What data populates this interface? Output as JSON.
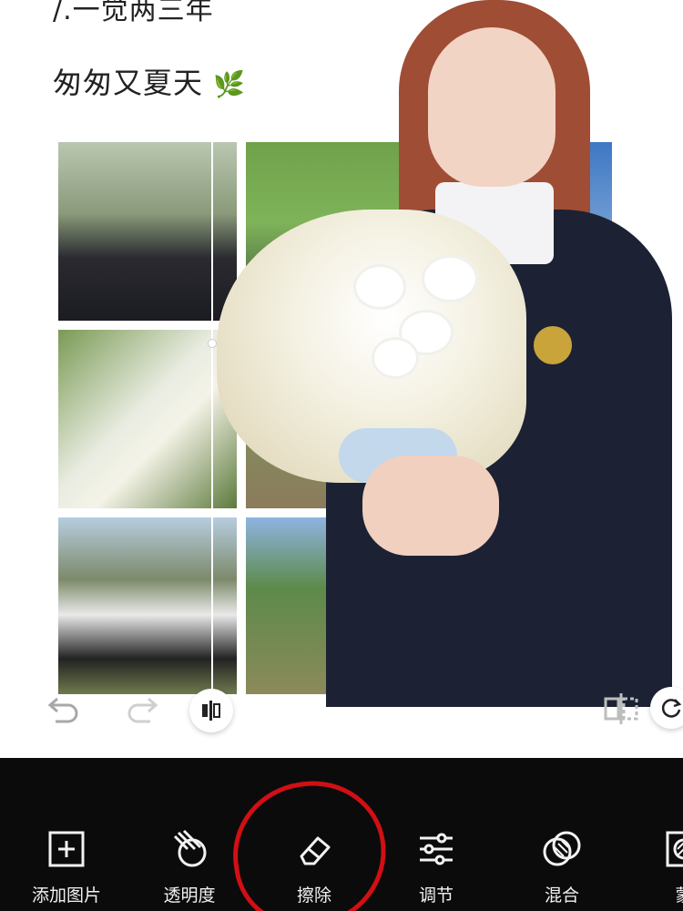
{
  "canvas": {
    "heading_1": "/.一觉两三年",
    "heading_2": "匆匆又夏天",
    "heading_2_emoji": "🌿"
  },
  "controls": {
    "undo_icon": "undo-icon",
    "redo_icon": "redo-icon",
    "compare_icon": "compare-icon",
    "flip_icon": "flip-icon",
    "rotate_icon": "rotate-icon"
  },
  "toolbar": {
    "tools": [
      {
        "id": "add-image",
        "label": "添加图片",
        "icon": "add-image-icon"
      },
      {
        "id": "opacity",
        "label": "透明度",
        "icon": "opacity-icon"
      },
      {
        "id": "erase",
        "label": "擦除",
        "icon": "eraser-icon"
      },
      {
        "id": "adjust",
        "label": "调节",
        "icon": "sliders-icon"
      },
      {
        "id": "blend",
        "label": "混合",
        "icon": "blend-icon"
      },
      {
        "id": "mask",
        "label": "蒙",
        "icon": "mask-icon"
      }
    ]
  },
  "colors": {
    "toolbar_bg": "#0b0b0b",
    "highlight": "#d10f14",
    "label_text": "#f2f2f2"
  }
}
